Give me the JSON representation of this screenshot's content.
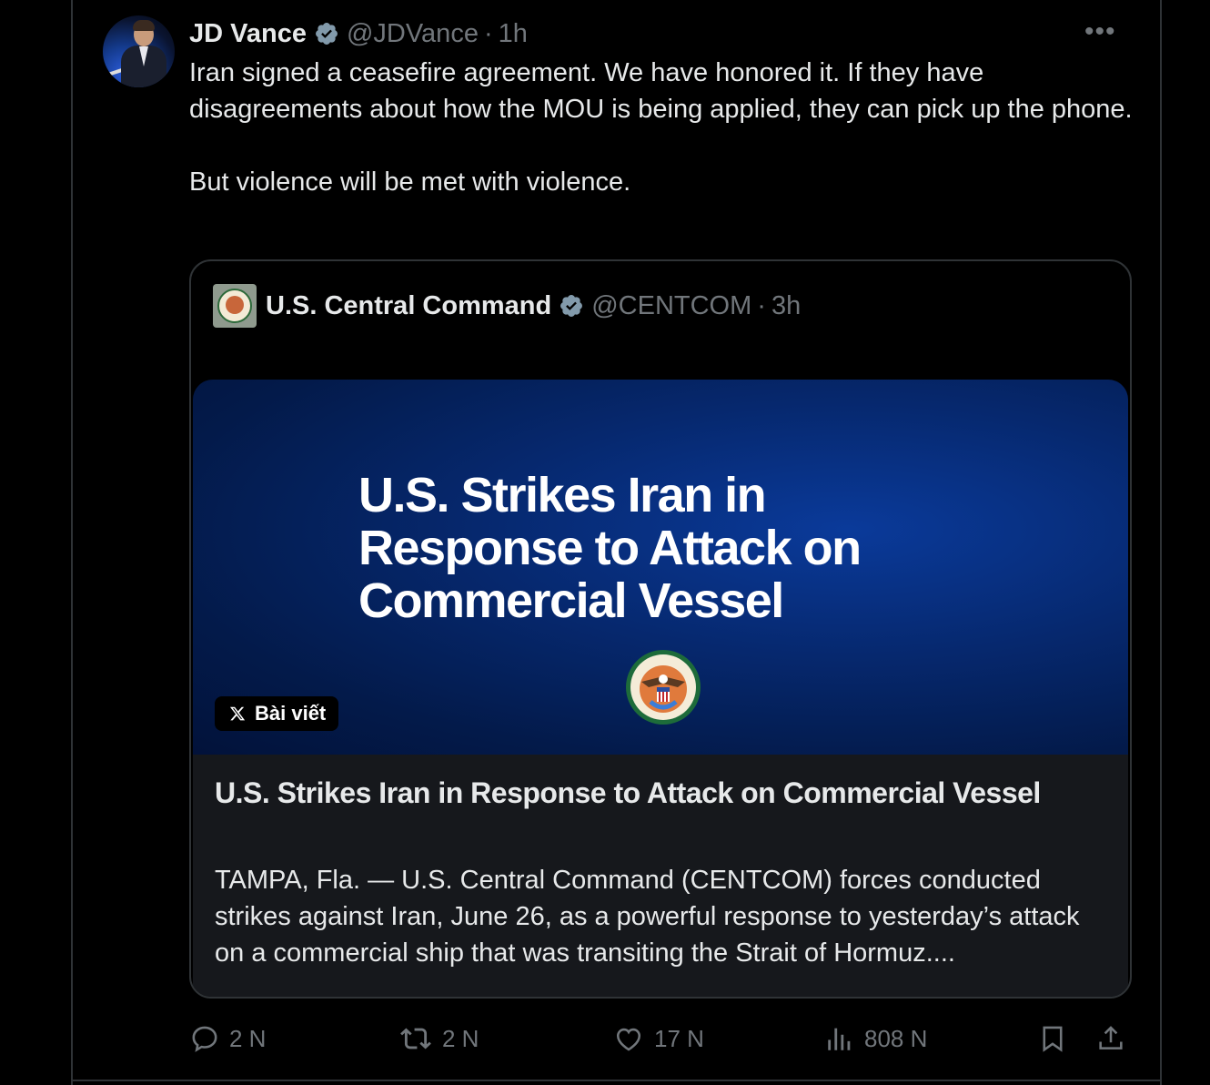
{
  "tweet": {
    "author_name": "JD Vance",
    "handle": "@JDVance",
    "separator": "·",
    "time": "1h",
    "text_lines": [
      "Iran signed a ceasefire agreement. We have honored it. If they have disagreements about how the MOU is being applied, they can pick up the phone.",
      "But violence will be met with violence."
    ]
  },
  "quoted": {
    "author_name": "U.S. Central Command",
    "handle": "@CENTCOM",
    "separator": "·",
    "time": "3h",
    "media_headline": "U.S. Strikes Iran in Response to Attack on Commercial Vessel",
    "badge_label": "Bài viết",
    "card_title": "U.S. Strikes Iran in Response to Attack on Commercial Vessel",
    "card_description": "TAMPA, Fla. — U.S. Central Command (CENTCOM) forces conducted strikes against Iran, June 26, as a powerful response to yesterday’s attack on a commercial ship that was transiting the Strait of Hormuz...."
  },
  "actions": {
    "replies": "2 N",
    "reposts": "2 N",
    "likes": "17 N",
    "views": "808 N"
  },
  "icons": [
    "verified-badge-icon",
    "more-icon",
    "x-logo-icon",
    "reply-icon",
    "repost-icon",
    "like-icon",
    "views-icon",
    "bookmark-icon",
    "share-icon"
  ],
  "colors": {
    "background": "#000000",
    "text": "#e7e9ea",
    "muted": "#71767b",
    "verified": "#829aab",
    "card": "#16181c",
    "media_blue": "#06286e"
  }
}
